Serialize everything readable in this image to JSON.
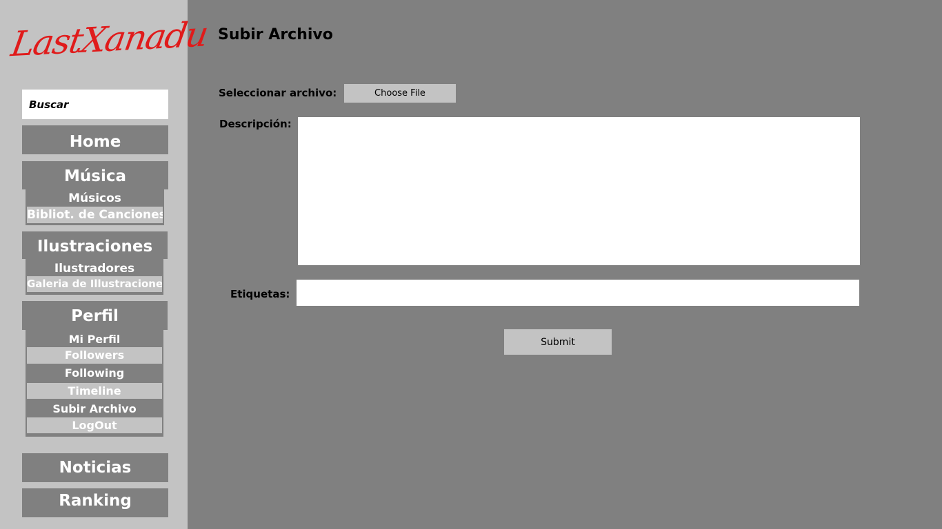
{
  "sidebar": {
    "logo": "LastXanadu",
    "search_placeholder": "Buscar",
    "home": "Home",
    "musica": {
      "label": "Música",
      "items": [
        "Músicos",
        "Bibliot. de Canciones"
      ]
    },
    "ilustraciones": {
      "label": "Ilustraciones",
      "items": [
        "Ilustradores",
        "Galeria de Illustraciones"
      ]
    },
    "perfil": {
      "label": "Perfil",
      "items": [
        "Mi Perfil",
        "Followers",
        "Following",
        "Timeline",
        "Subir Archivo",
        "LogOut"
      ]
    },
    "noticias": "Noticias",
    "ranking": "Ranking"
  },
  "main": {
    "title": "Subir Archivo",
    "file_label": "Seleccionar archivo:",
    "file_button": "Choose File",
    "description_label": "Descripción:",
    "description_value": "",
    "tags_label": "Etiquetas:",
    "tags_value": "",
    "submit": "Submit"
  },
  "colors": {
    "logo": "#e01b1b",
    "sidebar_bg": "#c3c3c3",
    "main_bg": "#808080"
  }
}
